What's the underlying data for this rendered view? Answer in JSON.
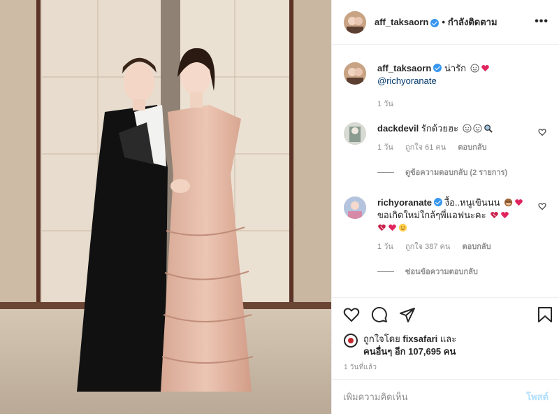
{
  "post": {
    "author": "aff_taksaorn",
    "header_separator": "•",
    "follow_status": "กำลังติดตาม",
    "more_icon": "more-horizontal-icon"
  },
  "caption": {
    "username": "aff_taksaorn",
    "text": "น่ารัก",
    "emojis": [
      "smiling-face-emoji",
      "red-heart-emoji"
    ],
    "mention": "@richyoranate",
    "time": "1 วัน"
  },
  "comments": [
    {
      "username": "dackdevil",
      "text": "รักด้วยฮะ",
      "emojis": [
        "smiling-face-emoji",
        "smiling-face-emoji",
        "magnifier-emoji"
      ],
      "time": "1 วัน",
      "likes": "ถูกใจ 61 คน",
      "reply": "ตอบกลับ",
      "thread": "ดูข้อความตอบกลับ (2 รายการ)"
    },
    {
      "username": "richyoranate",
      "text": "งื้อ..หนูเขินนน",
      "text_line2": "ขอเกิดใหม่ใกล้ๆพี่แอฟนะคะ",
      "emojis": [
        "see-no-evil-monkey-emoji",
        "red-heart-emoji",
        "heart-emoji",
        "red-heart-emoji",
        "heart-emoji",
        "red-heart-emoji",
        "smiling-face-emoji"
      ],
      "time": "1 วัน",
      "likes": "ถูกใจ 387 คน",
      "reply": "ตอบกลับ",
      "thread": "ซ่อนข้อความตอบกลับ"
    }
  ],
  "actions": {
    "like_icon": "heart-icon",
    "comment_icon": "comment-icon",
    "share_icon": "share-icon",
    "save_icon": "bookmark-icon"
  },
  "likes": {
    "prefix": "ถูกใจโดย",
    "user": "fixsafari",
    "and": "และ",
    "others": "คนอื่นๆ อีก 107,695 คน"
  },
  "time_ago": "1 วันที่แล้ว",
  "add_comment": {
    "placeholder": "เพิ่มความคิดเห็น",
    "post_label": "โพสต์"
  },
  "colors": {
    "verified": "#3897f0",
    "link": "#00376b",
    "muted": "#8e8e8e",
    "post_disabled": "#b2dffc",
    "heart": "#ed4956"
  }
}
